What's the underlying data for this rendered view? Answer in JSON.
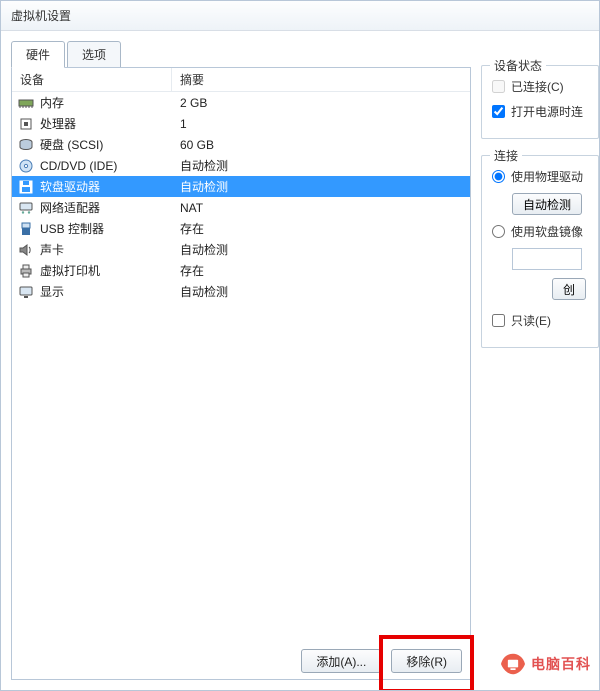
{
  "window": {
    "title": "虚拟机设置"
  },
  "tabs": {
    "hardware": "硬件",
    "options": "选项"
  },
  "table": {
    "head_device": "设备",
    "head_summary": "摘要",
    "rows": [
      {
        "icon": "memory",
        "name": "内存",
        "summary": "2 GB"
      },
      {
        "icon": "cpu",
        "name": "处理器",
        "summary": "1"
      },
      {
        "icon": "disk",
        "name": "硬盘 (SCSI)",
        "summary": "60 GB"
      },
      {
        "icon": "cd",
        "name": "CD/DVD (IDE)",
        "summary": "自动检测"
      },
      {
        "icon": "floppy",
        "name": "软盘驱动器",
        "summary": "自动检测",
        "selected": true
      },
      {
        "icon": "net",
        "name": "网络适配器",
        "summary": "NAT"
      },
      {
        "icon": "usb",
        "name": "USB 控制器",
        "summary": "存在"
      },
      {
        "icon": "sound",
        "name": "声卡",
        "summary": "自动检测"
      },
      {
        "icon": "printer",
        "name": "虚拟打印机",
        "summary": "存在"
      },
      {
        "icon": "display",
        "name": "显示",
        "summary": "自动检测"
      }
    ]
  },
  "buttons": {
    "add": "添加(A)...",
    "remove": "移除(R)"
  },
  "status_group": {
    "legend": "设备状态",
    "connected": "已连接(C)",
    "power_on": "打开电源时连"
  },
  "conn_group": {
    "legend": "连接",
    "use_physical": "使用物理驱动",
    "auto_detect": "自动检测",
    "use_image": "使用软盘镜像",
    "browse": "创",
    "readonly": "只读(E)"
  },
  "watermark": "电脑百科"
}
